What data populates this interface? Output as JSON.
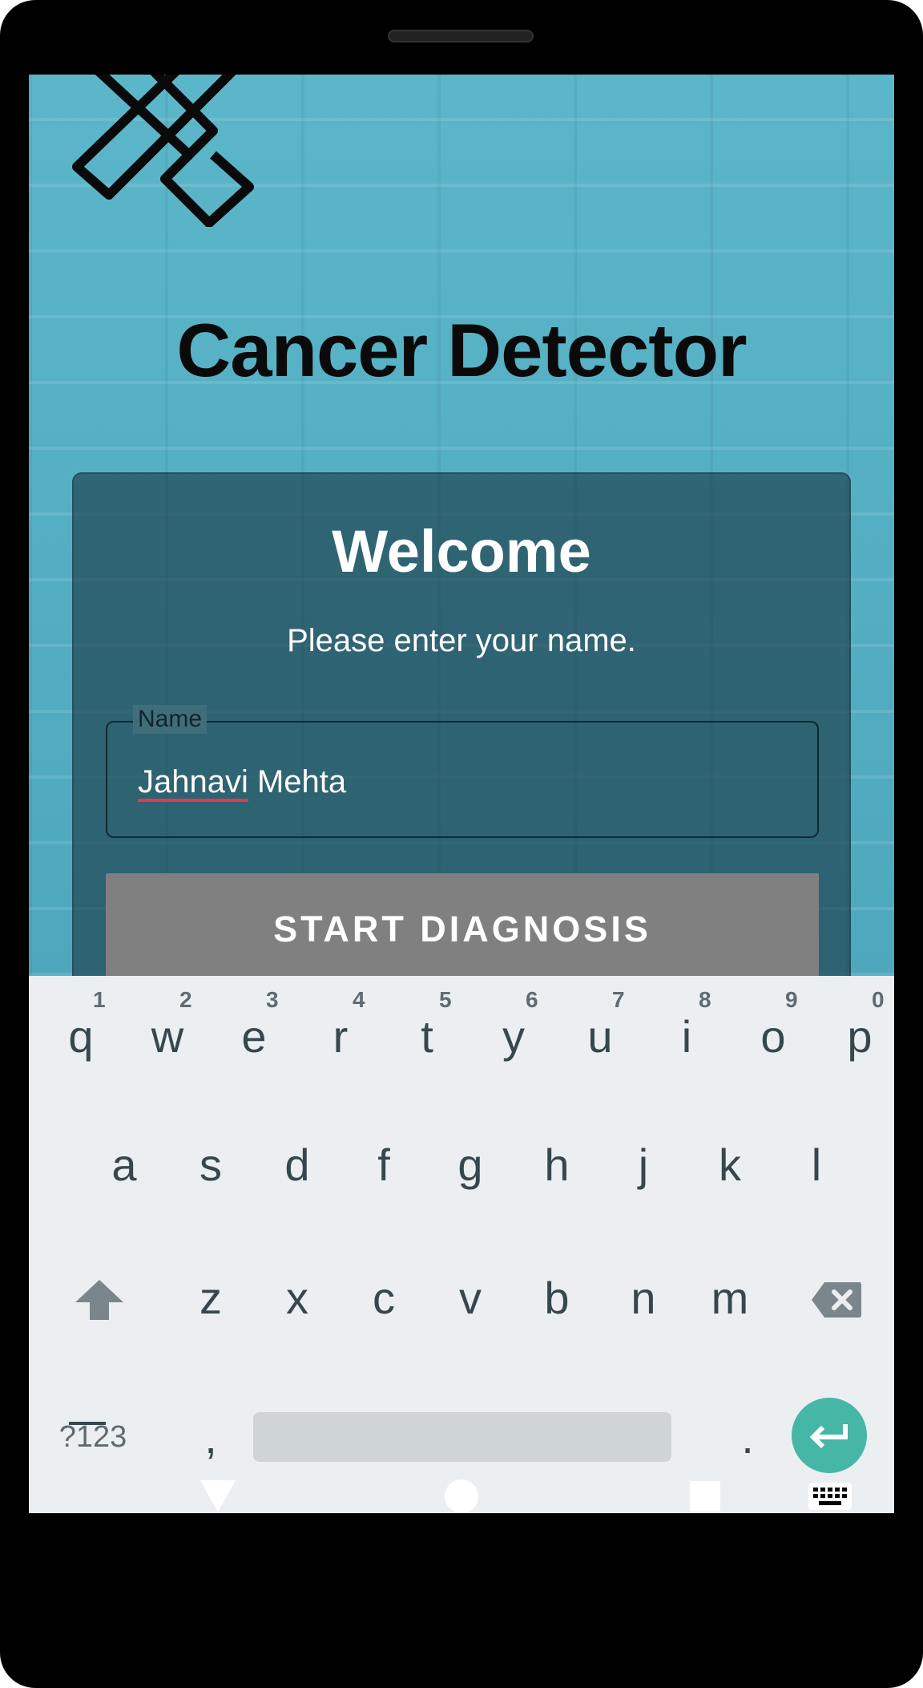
{
  "app": {
    "title": "Cancer Detector",
    "logo_icon": "ribbon-x-logo",
    "card": {
      "heading": "Welcome",
      "prompt": "Please enter your name.",
      "name_field": {
        "label": "Name",
        "value_first": "Jahnavi",
        "value_rest": " Mehta"
      },
      "start_button": "START DIAGNOSIS"
    }
  },
  "keyboard": {
    "row1": [
      {
        "key": "q",
        "hint": "1"
      },
      {
        "key": "w",
        "hint": "2"
      },
      {
        "key": "e",
        "hint": "3"
      },
      {
        "key": "r",
        "hint": "4"
      },
      {
        "key": "t",
        "hint": "5"
      },
      {
        "key": "y",
        "hint": "6"
      },
      {
        "key": "u",
        "hint": "7"
      },
      {
        "key": "i",
        "hint": "8"
      },
      {
        "key": "o",
        "hint": "9"
      },
      {
        "key": "p",
        "hint": "0"
      }
    ],
    "row2": [
      "a",
      "s",
      "d",
      "f",
      "g",
      "h",
      "j",
      "k",
      "l"
    ],
    "row3": [
      "z",
      "x",
      "c",
      "v",
      "b",
      "n",
      "m"
    ],
    "symbols_key": "?123",
    "comma_key": ",",
    "period_key": ".",
    "enter_color": "#46b6a6"
  },
  "navbar": {
    "icons": [
      "back-triangle-icon",
      "home-circle-icon",
      "recents-square-icon",
      "keyboard-switch-icon"
    ]
  }
}
